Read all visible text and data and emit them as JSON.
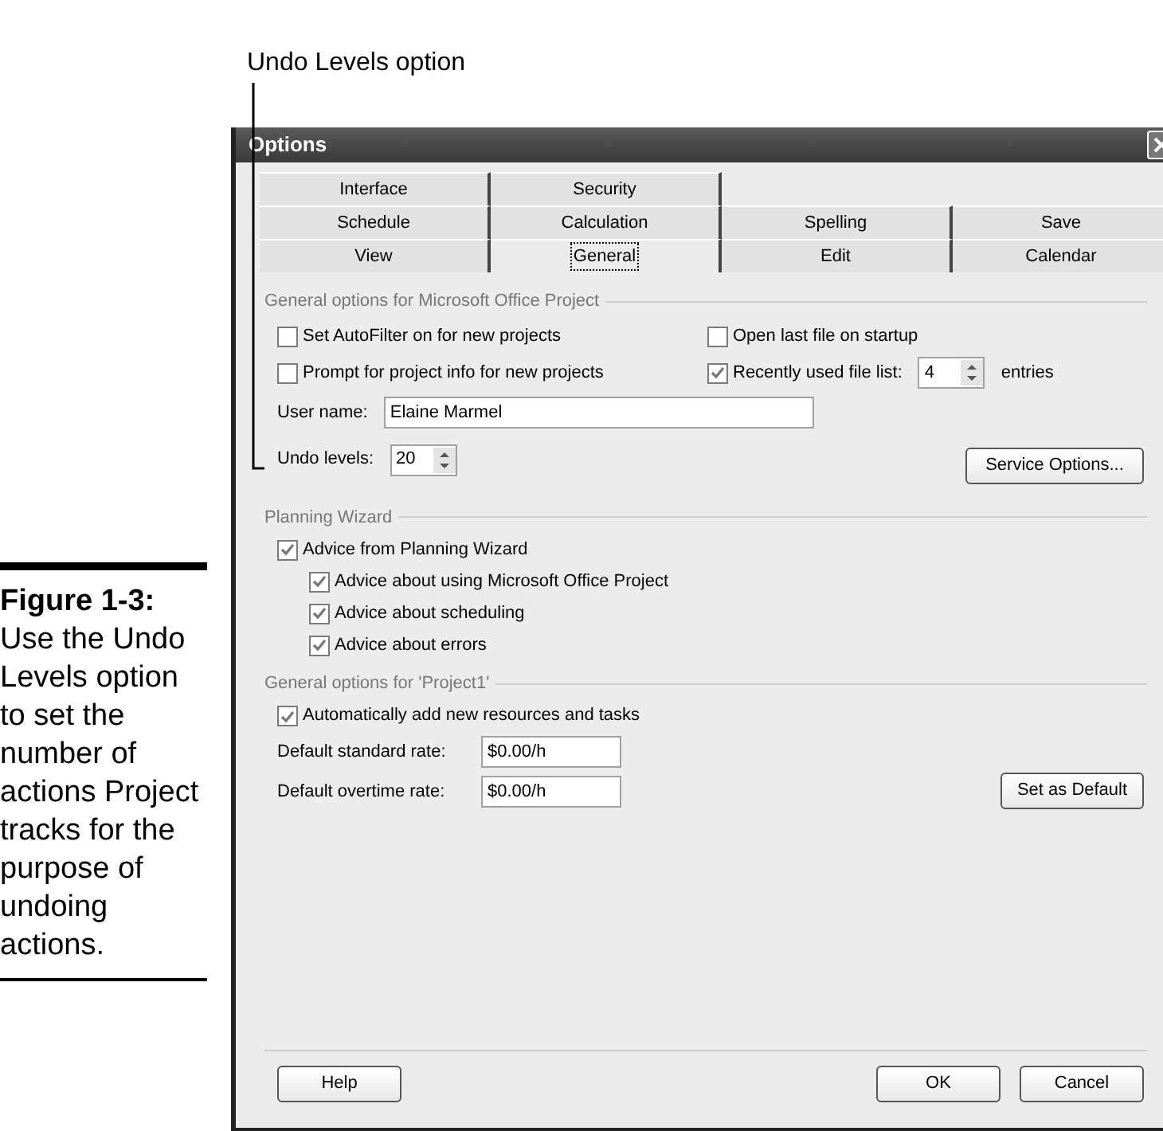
{
  "callout": {
    "label": "Undo Levels option"
  },
  "caption": {
    "title": "Figure 1-3:",
    "text": "Use the Undo Levels option to set the number of actions Project tracks for the purpose of undoing actions."
  },
  "window": {
    "title": "Options"
  },
  "tab_rows": [
    [
      {
        "label": "Interface",
        "selected": false
      },
      {
        "label": "Security",
        "selected": false
      }
    ],
    [
      {
        "label": "Schedule",
        "selected": false
      },
      {
        "label": "Calculation",
        "selected": false
      },
      {
        "label": "Spelling",
        "selected": false
      },
      {
        "label": "Save",
        "selected": false
      }
    ],
    [
      {
        "label": "View",
        "selected": false
      },
      {
        "label": "General",
        "selected": true
      },
      {
        "label": "Edit",
        "selected": false
      },
      {
        "label": "Calendar",
        "selected": false
      }
    ]
  ],
  "general": {
    "title": "General options for Microsoft Office Project",
    "options": [
      {
        "label": "Set AutoFilter on for new projects",
        "checked": false
      },
      {
        "label": "Open last file on startup",
        "checked": false
      },
      {
        "label": "Prompt for project info for new projects",
        "checked": false
      },
      {
        "label": "Recently used file list:",
        "checked": true,
        "value": "4",
        "suffix": "entries"
      }
    ],
    "user_name": {
      "label": "User name:",
      "value": "Elaine Marmel"
    },
    "undo_levels": {
      "label": "Undo levels:",
      "value": "20"
    },
    "button": "Service Options..."
  },
  "planning_wizard": {
    "title": "Planning Wizard",
    "options": [
      {
        "label": "Advice from Planning Wizard",
        "checked": true,
        "children": [
          {
            "label": "Advice about using Microsoft Office Project",
            "checked": true
          },
          {
            "label": "Advice about scheduling",
            "checked": true
          },
          {
            "label": "Advice about errors",
            "checked": true
          }
        ]
      }
    ]
  },
  "project": {
    "title": "General options for 'Project1'",
    "option": {
      "label": "Automatically add new resources and tasks",
      "checked": true
    },
    "fields": [
      {
        "label": "Default standard rate:",
        "value": "$0.00/h"
      },
      {
        "label": "Default overtime rate:",
        "value": "$0.00/h"
      }
    ],
    "button": "Set as Default"
  },
  "footer": {
    "buttons": [
      {
        "label": "Help",
        "kind": "left"
      },
      {
        "label": "OK",
        "kind": "right"
      },
      {
        "label": "Cancel",
        "kind": "right"
      }
    ]
  }
}
